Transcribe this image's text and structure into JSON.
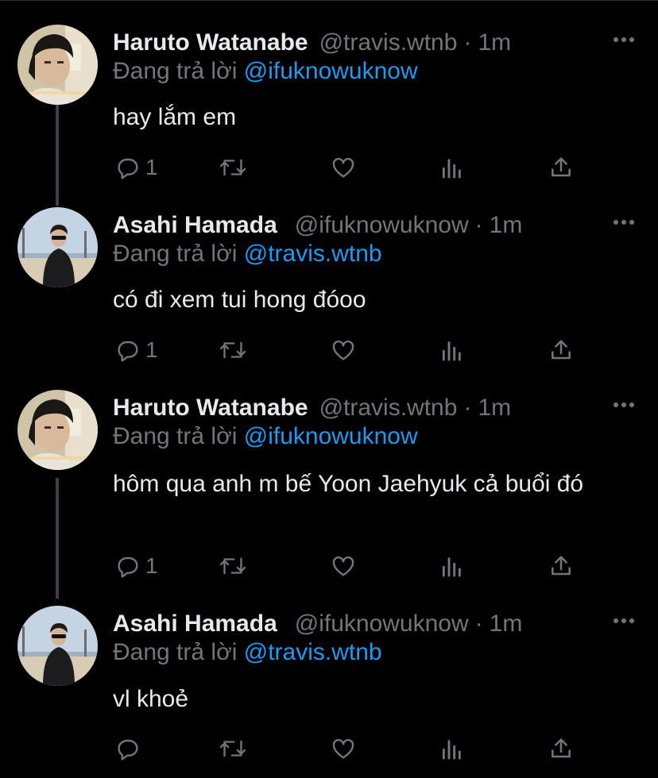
{
  "colors": {
    "background": "#000000",
    "text": "#e7e9ea",
    "muted": "#71767b",
    "link": "#1d9bf0",
    "divider": "#2f3336",
    "thread_line": "#3e4144"
  },
  "tweets": [
    {
      "name": "Haruto Watanabe",
      "handle": "@travis.wtnb",
      "separator": "·",
      "time": "1m",
      "reply_prefix": "Đang trả lời",
      "reply_handle": "@ifuknowuknow",
      "text": "hay lắm em",
      "reply_count": "1",
      "avatar": "haruto-avatar"
    },
    {
      "name": "Asahi Hamada",
      "handle": "@ifuknowuknow",
      "separator": "·",
      "time": "1m",
      "reply_prefix": "Đang trả lời",
      "reply_handle": "@travis.wtnb",
      "text": "có đi xem tui hong đóoo",
      "reply_count": "1",
      "avatar": "asahi-avatar"
    },
    {
      "name": "Haruto Watanabe",
      "handle": "@travis.wtnb",
      "separator": "·",
      "time": "1m",
      "reply_prefix": "Đang trả lời",
      "reply_handle": "@ifuknowuknow",
      "text": "hôm qua anh m bế Yoon Jaehyuk cả buổi đó",
      "reply_count": "1",
      "avatar": "haruto-avatar"
    },
    {
      "name": "Asahi Hamada",
      "handle": "@ifuknowuknow",
      "separator": "·",
      "time": "1m",
      "reply_prefix": "Đang trả lời",
      "reply_handle": "@travis.wtnb",
      "text": "vl khoẻ",
      "reply_count": "",
      "avatar": "asahi-avatar"
    }
  ],
  "icons": {
    "reply": "comment-icon",
    "retweet": "retweet-icon",
    "like": "heart-icon",
    "views": "analytics-icon",
    "share": "share-icon",
    "more": "more-icon"
  }
}
